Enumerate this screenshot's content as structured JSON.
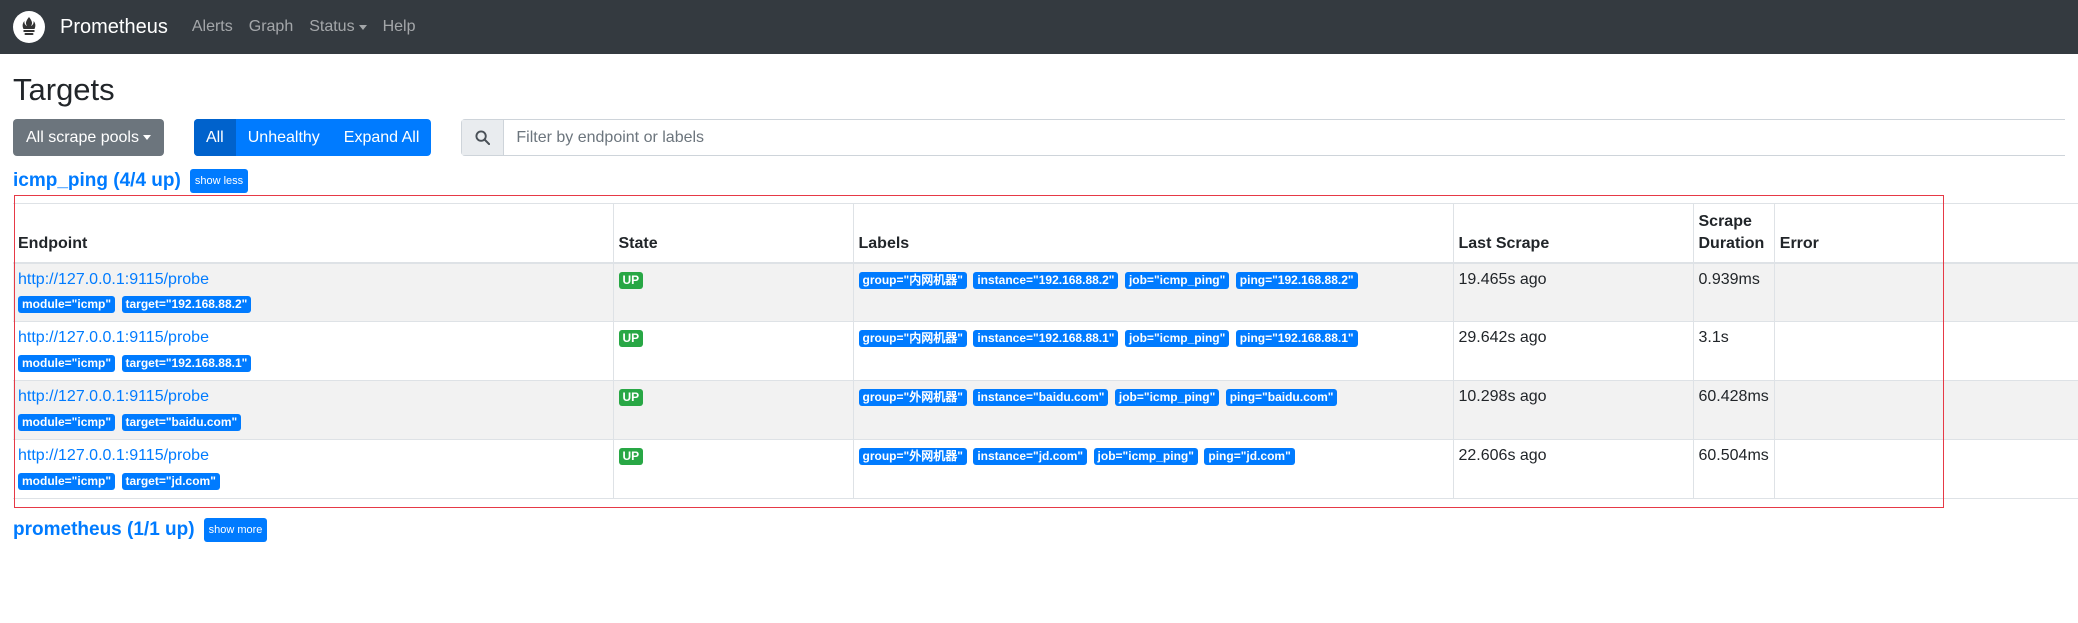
{
  "nav": {
    "brand": "Prometheus",
    "links": [
      "Alerts",
      "Graph",
      "Status",
      "Help"
    ]
  },
  "page_title": "Targets",
  "controls": {
    "pools_button": "All scrape pools",
    "filter_buttons": [
      "All",
      "Unhealthy",
      "Expand All"
    ],
    "search_placeholder": "Filter by endpoint or labels"
  },
  "pools": [
    {
      "title": "icmp_ping (4/4 up)",
      "toggle": "show less",
      "columns": [
        "Endpoint",
        "State",
        "Labels",
        "Last Scrape",
        "Scrape Duration",
        "Error"
      ],
      "rows": [
        {
          "endpoint": "http://127.0.0.1:9115/probe",
          "params": [
            "module=\"icmp\"",
            "target=\"192.168.88.2\""
          ],
          "state": "UP",
          "labels": [
            "group=\"内网机器\"",
            "instance=\"192.168.88.2\"",
            "job=\"icmp_ping\"",
            "ping=\"192.168.88.2\""
          ],
          "last_scrape": "19.465s ago",
          "duration": "0.939ms",
          "error": ""
        },
        {
          "endpoint": "http://127.0.0.1:9115/probe",
          "params": [
            "module=\"icmp\"",
            "target=\"192.168.88.1\""
          ],
          "state": "UP",
          "labels": [
            "group=\"内网机器\"",
            "instance=\"192.168.88.1\"",
            "job=\"icmp_ping\"",
            "ping=\"192.168.88.1\""
          ],
          "last_scrape": "29.642s ago",
          "duration": "3.1s",
          "error": ""
        },
        {
          "endpoint": "http://127.0.0.1:9115/probe",
          "params": [
            "module=\"icmp\"",
            "target=\"baidu.com\""
          ],
          "state": "UP",
          "labels": [
            "group=\"外网机器\"",
            "instance=\"baidu.com\"",
            "job=\"icmp_ping\"",
            "ping=\"baidu.com\""
          ],
          "last_scrape": "10.298s ago",
          "duration": "60.428ms",
          "error": ""
        },
        {
          "endpoint": "http://127.0.0.1:9115/probe",
          "params": [
            "module=\"icmp\"",
            "target=\"jd.com\""
          ],
          "state": "UP",
          "labels": [
            "group=\"外网机器\"",
            "instance=\"jd.com\"",
            "job=\"icmp_ping\"",
            "ping=\"jd.com\""
          ],
          "last_scrape": "22.606s ago",
          "duration": "60.504ms",
          "error": ""
        }
      ]
    },
    {
      "title": "prometheus (1/1 up)",
      "toggle": "show more"
    }
  ],
  "colors": {
    "navbar": "#343a40",
    "primary": "#007bff",
    "success": "#28a745",
    "secondary": "#6c757d",
    "highlight_frame": "#e63946"
  }
}
